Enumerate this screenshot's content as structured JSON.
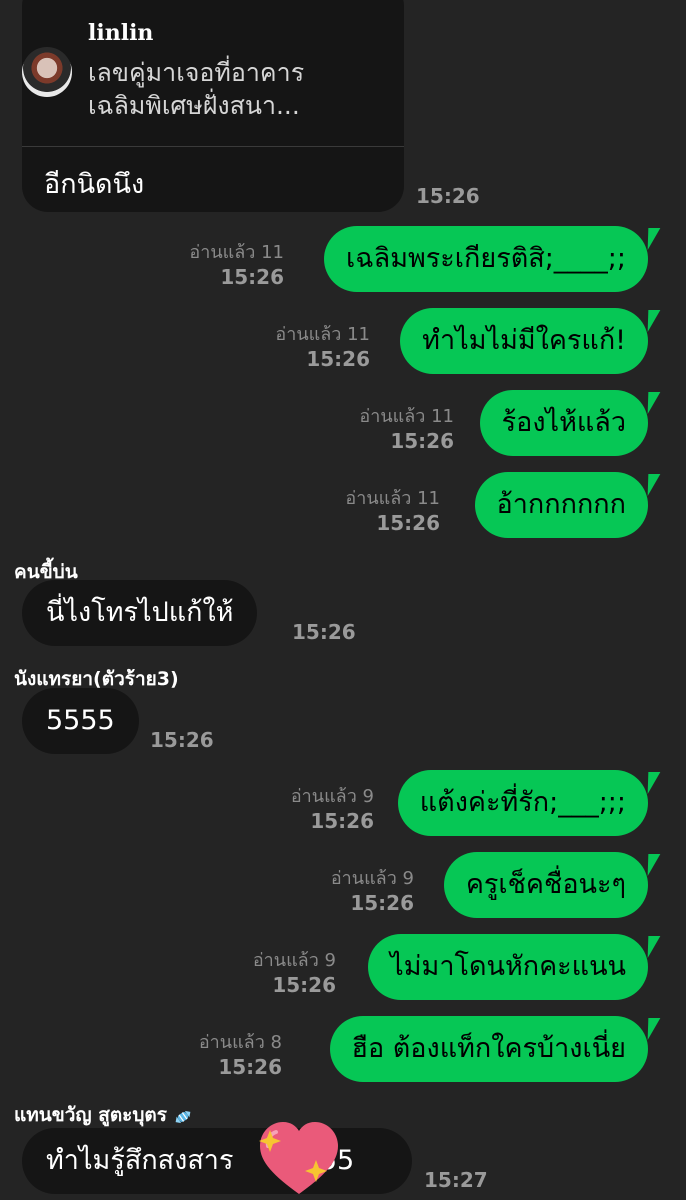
{
  "reply": {
    "name": "linlin",
    "quote_line1": "เลขคู่มาเจอที่อาคาร",
    "quote_line2": "เฉลิมพิเศษฝั่งสนา...",
    "text": "อีกนิดนึง",
    "time": "15:26"
  },
  "outgoing1": [
    {
      "text": "เฉลิมพระเกียรติสิ;____;;",
      "read": "อ่านแล้ว 11",
      "time": "15:26"
    },
    {
      "text": "ทำไมไม่มีใครแก้!",
      "read": "อ่านแล้ว 11",
      "time": "15:26"
    },
    {
      "text": "ร้องไห้แล้ว",
      "read": "อ่านแล้ว 11",
      "time": "15:26"
    },
    {
      "text": "อ้ากกกกกก",
      "read": "อ่านแล้ว 11",
      "time": "15:26"
    }
  ],
  "incoming1": {
    "sender": "คนขี้บ่น",
    "text": "นี่ไงโทรไปแก้ให้",
    "time": "15:26"
  },
  "incoming2": {
    "sender": "นังแทรยา(ตัวร้าย3)",
    "text": "5555",
    "time": "15:26"
  },
  "outgoing2": [
    {
      "text": "แต้งค่ะที่รัก;___;;;",
      "read": "อ่านแล้ว 9",
      "time": "15:26"
    },
    {
      "text": "ครูเช็คชื่อนะๆ",
      "read": "อ่านแล้ว 9",
      "time": "15:26"
    },
    {
      "text": "ไม่มาโดนหักคะแนน",
      "read": "อ่านแล้ว 9",
      "time": "15:26"
    },
    {
      "text": "ฮือ ต้องแท็กใครบ้างเนี่ย",
      "read": "อ่านแล้ว 8",
      "time": "15:26"
    }
  ],
  "incoming3": {
    "sender": "แทนขวัญ สูตะบุตร",
    "text": "ทำไมรู้สึกสงสาร",
    "text_tail": "5555",
    "time": "15:27"
  },
  "colors": {
    "background": "#242424",
    "outgoing_bubble": "#06c755",
    "incoming_bubble": "#151515"
  },
  "icons": {
    "sticker": "heart-sparkle-sticker",
    "emoji": "candy-emoji"
  }
}
